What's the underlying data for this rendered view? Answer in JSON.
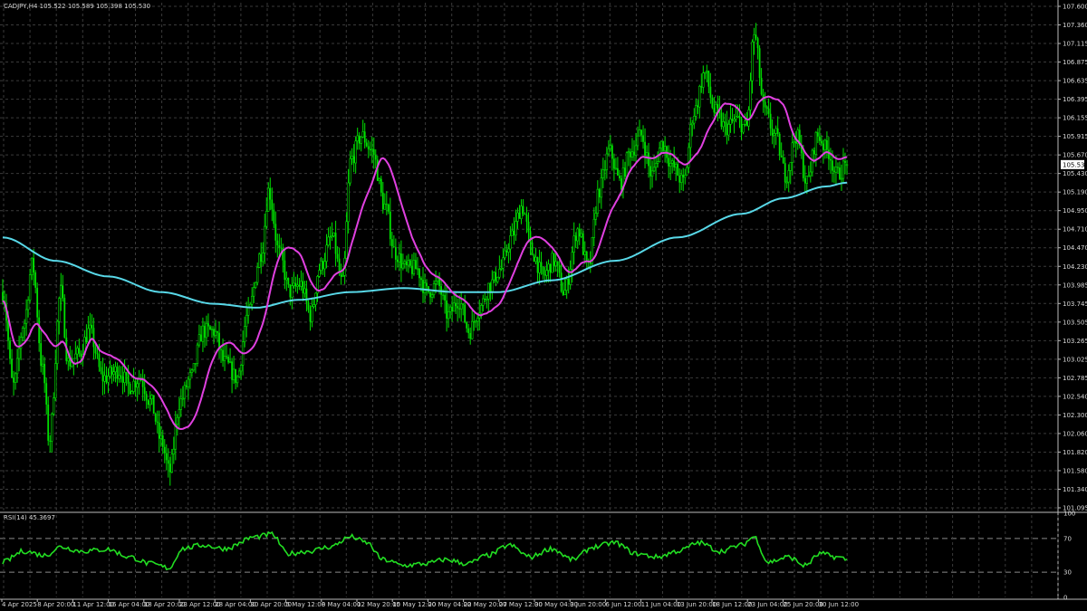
{
  "symbol_header": "CADJPY,H4  105.522 105.589 105.398 105.530",
  "rsi_header": "RSI(14) 45.3697",
  "current_price_tag": "105.530",
  "colors": {
    "background": "#000000",
    "grid": "#3a3a3a",
    "candle_up": "#00e000",
    "candle_down": "#00e000",
    "ma_fast": "#e040e0",
    "ma_slow": "#58d8e8",
    "rsi_line": "#22dd22",
    "text": "#d8d8d8",
    "price_tag_bg": "#ffffff"
  },
  "price_axis_labels": [
    "107.600",
    "107.360",
    "107.115",
    "106.875",
    "106.635",
    "106.395",
    "106.155",
    "105.915",
    "105.670",
    "105.430",
    "105.190",
    "104.950",
    "104.710",
    "104.470",
    "104.230",
    "103.985",
    "103.745",
    "103.505",
    "103.265",
    "103.025",
    "102.785",
    "102.540",
    "102.300",
    "102.060",
    "101.820",
    "101.580",
    "101.340",
    "101.095"
  ],
  "rsi_axis_labels": [
    "100",
    "70",
    "30",
    "0"
  ],
  "time_axis_labels": [
    "4 Apr 2025",
    "8 Apr 20:00",
    "11 Apr 12:00",
    "16 Apr 04:00",
    "18 Apr 20:00",
    "23 Apr 12:00",
    "28 Apr 04:00",
    "30 Apr 20:00",
    "5 May 12:00",
    "8 May 04:00",
    "12 May 20:00",
    "15 May 12:00",
    "20 May 04:00",
    "22 May 20:00",
    "27 May 12:00",
    "30 May 04:00",
    "3 Jun 20:00",
    "6 Jun 12:00",
    "11 Jun 04:00",
    "13 Jun 20:00",
    "18 Jun 12:00",
    "23 Jun 04:00",
    "25 Jun 20:00",
    "30 Jun 12:00"
  ],
  "chart_data": {
    "type": "candlestick",
    "symbol": "CADJPY",
    "timeframe": "H4",
    "last": {
      "open": 105.522,
      "high": 105.589,
      "low": 105.398,
      "close": 105.53
    },
    "ylim": [
      101.095,
      107.6
    ],
    "grid": true,
    "x_range": [
      "4 Apr 2025",
      "30 Jun 12:00"
    ],
    "close_anchors": [
      {
        "t": 0.0,
        "v": 103.9
      },
      {
        "t": 0.01,
        "v": 102.7
      },
      {
        "t": 0.02,
        "v": 103.5
      },
      {
        "t": 0.028,
        "v": 104.25
      },
      {
        "t": 0.038,
        "v": 102.9
      },
      {
        "t": 0.044,
        "v": 102.0
      },
      {
        "t": 0.055,
        "v": 103.9
      },
      {
        "t": 0.062,
        "v": 103.0
      },
      {
        "t": 0.072,
        "v": 103.1
      },
      {
        "t": 0.082,
        "v": 103.4
      },
      {
        "t": 0.095,
        "v": 102.8
      },
      {
        "t": 0.11,
        "v": 102.9
      },
      {
        "t": 0.12,
        "v": 102.7
      },
      {
        "t": 0.13,
        "v": 102.8
      },
      {
        "t": 0.14,
        "v": 102.5
      },
      {
        "t": 0.15,
        "v": 102.0
      },
      {
        "t": 0.158,
        "v": 101.6
      },
      {
        "t": 0.168,
        "v": 102.5
      },
      {
        "t": 0.178,
        "v": 102.8
      },
      {
        "t": 0.19,
        "v": 103.4
      },
      {
        "t": 0.2,
        "v": 103.4
      },
      {
        "t": 0.21,
        "v": 103.0
      },
      {
        "t": 0.222,
        "v": 102.8
      },
      {
        "t": 0.232,
        "v": 103.6
      },
      {
        "t": 0.245,
        "v": 104.4
      },
      {
        "t": 0.252,
        "v": 105.2
      },
      {
        "t": 0.262,
        "v": 104.4
      },
      {
        "t": 0.272,
        "v": 103.9
      },
      {
        "t": 0.282,
        "v": 104.0
      },
      {
        "t": 0.292,
        "v": 103.6
      },
      {
        "t": 0.3,
        "v": 104.2
      },
      {
        "t": 0.312,
        "v": 104.6
      },
      {
        "t": 0.322,
        "v": 104.0
      },
      {
        "t": 0.33,
        "v": 105.6
      },
      {
        "t": 0.34,
        "v": 105.9
      },
      {
        "t": 0.35,
        "v": 105.7
      },
      {
        "t": 0.362,
        "v": 105.0
      },
      {
        "t": 0.372,
        "v": 104.4
      },
      {
        "t": 0.382,
        "v": 104.2
      },
      {
        "t": 0.392,
        "v": 104.2
      },
      {
        "t": 0.402,
        "v": 103.9
      },
      {
        "t": 0.412,
        "v": 104.0
      },
      {
        "t": 0.422,
        "v": 103.6
      },
      {
        "t": 0.432,
        "v": 103.8
      },
      {
        "t": 0.442,
        "v": 103.4
      },
      {
        "t": 0.452,
        "v": 103.7
      },
      {
        "t": 0.462,
        "v": 104.0
      },
      {
        "t": 0.472,
        "v": 104.2
      },
      {
        "t": 0.482,
        "v": 104.6
      },
      {
        "t": 0.492,
        "v": 105.0
      },
      {
        "t": 0.502,
        "v": 104.4
      },
      {
        "t": 0.512,
        "v": 104.1
      },
      {
        "t": 0.522,
        "v": 104.3
      },
      {
        "t": 0.532,
        "v": 103.9
      },
      {
        "t": 0.545,
        "v": 104.7
      },
      {
        "t": 0.555,
        "v": 104.2
      },
      {
        "t": 0.565,
        "v": 105.2
      },
      {
        "t": 0.575,
        "v": 105.7
      },
      {
        "t": 0.585,
        "v": 105.3
      },
      {
        "t": 0.595,
        "v": 105.7
      },
      {
        "t": 0.605,
        "v": 105.9
      },
      {
        "t": 0.615,
        "v": 105.4
      },
      {
        "t": 0.625,
        "v": 105.8
      },
      {
        "t": 0.635,
        "v": 105.5
      },
      {
        "t": 0.645,
        "v": 105.3
      },
      {
        "t": 0.655,
        "v": 106.2
      },
      {
        "t": 0.665,
        "v": 106.7
      },
      {
        "t": 0.675,
        "v": 106.2
      },
      {
        "t": 0.685,
        "v": 106.0
      },
      {
        "t": 0.695,
        "v": 106.1
      },
      {
        "t": 0.705,
        "v": 106.0
      },
      {
        "t": 0.712,
        "v": 107.2
      },
      {
        "t": 0.722,
        "v": 106.2
      },
      {
        "t": 0.732,
        "v": 105.9
      },
      {
        "t": 0.742,
        "v": 105.4
      },
      {
        "t": 0.752,
        "v": 105.9
      },
      {
        "t": 0.762,
        "v": 105.3
      },
      {
        "t": 0.772,
        "v": 105.9
      },
      {
        "t": 0.782,
        "v": 105.7
      },
      {
        "t": 0.79,
        "v": 105.4
      },
      {
        "t": 0.8,
        "v": 105.53
      }
    ],
    "ma_fast_label": "",
    "ma_slow_anchors": [
      {
        "t": 0.0,
        "v": 104.6
      },
      {
        "t": 0.05,
        "v": 104.3
      },
      {
        "t": 0.1,
        "v": 104.1
      },
      {
        "t": 0.15,
        "v": 103.9
      },
      {
        "t": 0.2,
        "v": 103.75
      },
      {
        "t": 0.24,
        "v": 103.7
      },
      {
        "t": 0.28,
        "v": 103.8
      },
      {
        "t": 0.33,
        "v": 103.9
      },
      {
        "t": 0.38,
        "v": 103.95
      },
      {
        "t": 0.43,
        "v": 103.9
      },
      {
        "t": 0.47,
        "v": 103.9
      },
      {
        "t": 0.52,
        "v": 104.05
      },
      {
        "t": 0.58,
        "v": 104.3
      },
      {
        "t": 0.64,
        "v": 104.6
      },
      {
        "t": 0.7,
        "v": 104.9
      },
      {
        "t": 0.74,
        "v": 105.1
      },
      {
        "t": 0.78,
        "v": 105.25
      },
      {
        "t": 0.8,
        "v": 105.3
      }
    ],
    "rsi": {
      "period": 14,
      "last": 45.3697,
      "levels": [
        70,
        30
      ],
      "ylim": [
        0,
        100
      ],
      "anchors": [
        {
          "t": 0.0,
          "v": 42
        },
        {
          "t": 0.02,
          "v": 55
        },
        {
          "t": 0.04,
          "v": 50
        },
        {
          "t": 0.055,
          "v": 60
        },
        {
          "t": 0.075,
          "v": 55
        },
        {
          "t": 0.1,
          "v": 57
        },
        {
          "t": 0.12,
          "v": 48
        },
        {
          "t": 0.14,
          "v": 40
        },
        {
          "t": 0.158,
          "v": 35
        },
        {
          "t": 0.17,
          "v": 58
        },
        {
          "t": 0.19,
          "v": 62
        },
        {
          "t": 0.21,
          "v": 58
        },
        {
          "t": 0.24,
          "v": 72
        },
        {
          "t": 0.255,
          "v": 75
        },
        {
          "t": 0.27,
          "v": 52
        },
        {
          "t": 0.29,
          "v": 55
        },
        {
          "t": 0.31,
          "v": 60
        },
        {
          "t": 0.33,
          "v": 72
        },
        {
          "t": 0.345,
          "v": 65
        },
        {
          "t": 0.36,
          "v": 45
        },
        {
          "t": 0.38,
          "v": 38
        },
        {
          "t": 0.4,
          "v": 40
        },
        {
          "t": 0.42,
          "v": 45
        },
        {
          "t": 0.44,
          "v": 40
        },
        {
          "t": 0.46,
          "v": 50
        },
        {
          "t": 0.48,
          "v": 62
        },
        {
          "t": 0.5,
          "v": 48
        },
        {
          "t": 0.52,
          "v": 58
        },
        {
          "t": 0.54,
          "v": 45
        },
        {
          "t": 0.56,
          "v": 60
        },
        {
          "t": 0.58,
          "v": 65
        },
        {
          "t": 0.6,
          "v": 52
        },
        {
          "t": 0.62,
          "v": 48
        },
        {
          "t": 0.64,
          "v": 55
        },
        {
          "t": 0.66,
          "v": 65
        },
        {
          "t": 0.68,
          "v": 55
        },
        {
          "t": 0.7,
          "v": 62
        },
        {
          "t": 0.712,
          "v": 72
        },
        {
          "t": 0.725,
          "v": 42
        },
        {
          "t": 0.745,
          "v": 48
        },
        {
          "t": 0.76,
          "v": 38
        },
        {
          "t": 0.775,
          "v": 52
        },
        {
          "t": 0.79,
          "v": 48
        },
        {
          "t": 0.8,
          "v": 45.37
        }
      ]
    }
  }
}
